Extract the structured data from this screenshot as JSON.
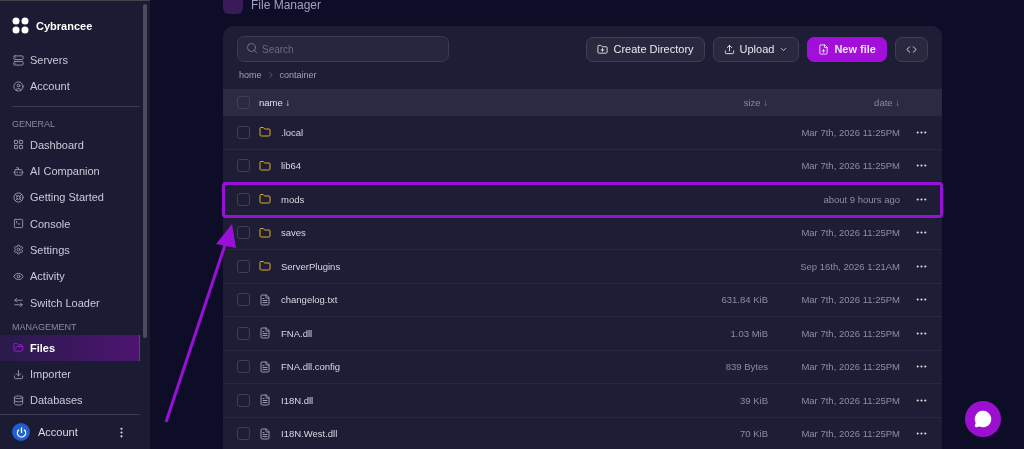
{
  "sidebar": {
    "brand": "Cybrancee",
    "items": [
      {
        "kind": "item",
        "label": "Servers",
        "selected": false
      },
      {
        "kind": "item",
        "label": "Account",
        "selected": false
      },
      {
        "kind": "divider"
      },
      {
        "kind": "section",
        "label": "GENERAL"
      },
      {
        "kind": "item",
        "label": "Dashboard",
        "selected": false
      },
      {
        "kind": "item",
        "label": "AI Companion",
        "selected": false
      },
      {
        "kind": "item",
        "label": "Getting Started",
        "selected": false
      },
      {
        "kind": "item",
        "label": "Console",
        "selected": false
      },
      {
        "kind": "item",
        "label": "Settings",
        "selected": false
      },
      {
        "kind": "item",
        "label": "Activity",
        "selected": false
      },
      {
        "kind": "item",
        "label": "Switch Loader",
        "selected": false
      },
      {
        "kind": "section",
        "label": "MANAGEMENT"
      },
      {
        "kind": "item",
        "label": "Files",
        "selected": true
      },
      {
        "kind": "item",
        "label": "Importer",
        "selected": false
      },
      {
        "kind": "item",
        "label": "Databases",
        "selected": false
      }
    ],
    "account": {
      "label": "Account"
    }
  },
  "page_title": "File Manager",
  "toolbar": {
    "search": {
      "placeholder": "Search"
    },
    "buttons": [
      {
        "kind": "outline",
        "label": "Create Directory"
      },
      {
        "kind": "dropdown",
        "label": "Upload"
      },
      {
        "kind": "primary",
        "label": "New file"
      },
      {
        "kind": "icon"
      }
    ]
  },
  "breadcrumb": [
    "home",
    "container"
  ],
  "table": {
    "all_checked": false,
    "columns": [
      {
        "label": "name ↓",
        "sorted": true
      },
      {
        "label": "size ↓",
        "sorted": false
      },
      {
        "label": "date ↓",
        "sorted": false
      }
    ],
    "rows": [
      {
        "kind": "folder",
        "name": ".local",
        "date": "Mar 7th, 2026 11:25PM",
        "highlighted": false,
        "checked": false
      },
      {
        "kind": "folder",
        "name": "lib64",
        "date": "Mar 7th, 2026 11:25PM",
        "highlighted": false,
        "checked": false
      },
      {
        "kind": "folder",
        "name": "mods",
        "date": "about 9 hours ago",
        "highlighted": true,
        "checked": false
      },
      {
        "kind": "folder",
        "name": "saves",
        "date": "Mar 7th, 2026 11:25PM",
        "highlighted": false,
        "checked": false
      },
      {
        "kind": "folder",
        "name": "ServerPlugins",
        "date": "Sep 16th, 2026 1:21AM",
        "highlighted": false,
        "checked": false
      },
      {
        "kind": "file",
        "name": "changelog.txt",
        "size": "631.84 KiB",
        "date": "Mar 7th, 2026 11:25PM",
        "highlighted": false,
        "checked": false
      },
      {
        "kind": "file",
        "name": "FNA.dll",
        "size": "1.03 MiB",
        "date": "Mar 7th, 2026 11:25PM",
        "highlighted": false,
        "checked": false
      },
      {
        "kind": "file",
        "name": "FNA.dll.config",
        "size": "839 Bytes",
        "date": "Mar 7th, 2026 11:25PM",
        "highlighted": false,
        "checked": false
      },
      {
        "kind": "file",
        "name": "I18N.dll",
        "size": "39 KiB",
        "date": "Mar 7th, 2026 11:25PM",
        "highlighted": false,
        "checked": false
      },
      {
        "kind": "file",
        "name": "I18N.West.dll",
        "size": "70 KiB",
        "date": "Mar 7th, 2026 11:25PM",
        "highlighted": false,
        "checked": false
      }
    ]
  },
  "annotation": {
    "kind": "arrow"
  },
  "chat_button": {
    "kind": "chat"
  }
}
